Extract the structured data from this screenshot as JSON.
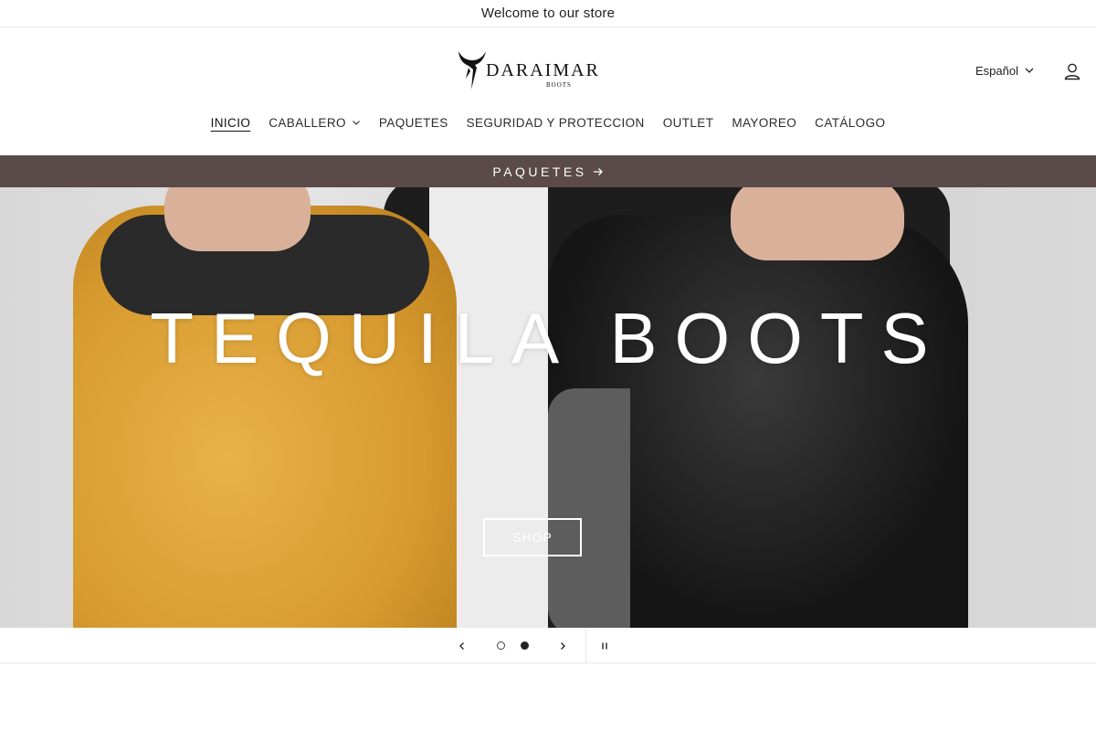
{
  "announcement": {
    "text": "Welcome to our store"
  },
  "header": {
    "logo": {
      "wordmark": "DARAIMAR",
      "sub": "BOOTS"
    },
    "language": {
      "selected": "Español"
    }
  },
  "nav": {
    "items": [
      {
        "label": "INICIO",
        "active": true,
        "has_dropdown": false
      },
      {
        "label": "CABALLERO",
        "active": false,
        "has_dropdown": true
      },
      {
        "label": "PAQUETES",
        "active": false,
        "has_dropdown": false
      },
      {
        "label": "SEGURIDAD Y PROTECCION",
        "active": false,
        "has_dropdown": false
      },
      {
        "label": "OUTLET",
        "active": false,
        "has_dropdown": false
      },
      {
        "label": "MAYOREO",
        "active": false,
        "has_dropdown": false
      },
      {
        "label": "CATÁLOGO",
        "active": false,
        "has_dropdown": false
      }
    ]
  },
  "promo_bar": {
    "text": "PAQUETES",
    "color": "#5a4a49"
  },
  "hero": {
    "title": "TEQUILA BOOTS",
    "button_label": "SHOP",
    "slides_total": 2,
    "active_slide": 2
  },
  "icons": {
    "account": "user-icon",
    "language_chevron": "chevron-down-icon",
    "prev": "chevron-left-icon",
    "next": "chevron-right-icon",
    "pause": "pause-icon",
    "promo_arrow": "arrow-right-icon"
  }
}
